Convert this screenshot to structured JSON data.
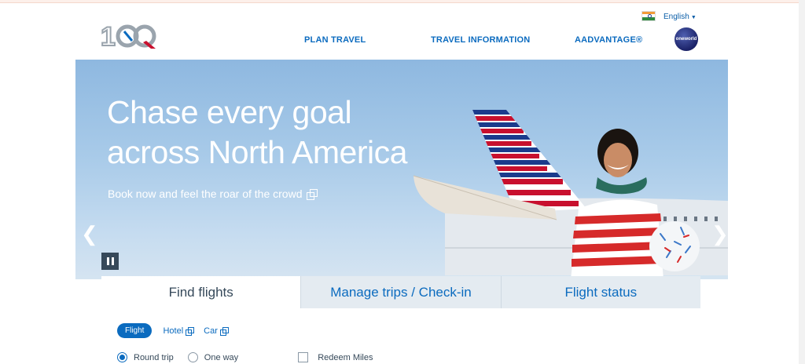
{
  "header": {
    "logo_text": "100",
    "language": "English",
    "oneworld_label": "oneworld",
    "nav": [
      "PLAN TRAVEL",
      "TRAVEL INFORMATION",
      "AADVANTAGE®"
    ]
  },
  "hero": {
    "headline_line1": "Chase every goal",
    "headline_line2": "across North America",
    "subline": "Book now and feel the roar of the crowd"
  },
  "booking": {
    "tabs": [
      "Find flights",
      "Manage trips / Check-in",
      "Flight status"
    ],
    "subtabs": {
      "flight": "Flight",
      "hotel": "Hotel",
      "car": "Car"
    },
    "trip_options": {
      "round_trip": "Round trip",
      "one_way": "One way",
      "redeem": "Redeem Miles"
    }
  },
  "colors": {
    "brand_blue": "#0b6bbf",
    "text_dark": "#36495a",
    "tab_bg": "#e4ebf1"
  }
}
